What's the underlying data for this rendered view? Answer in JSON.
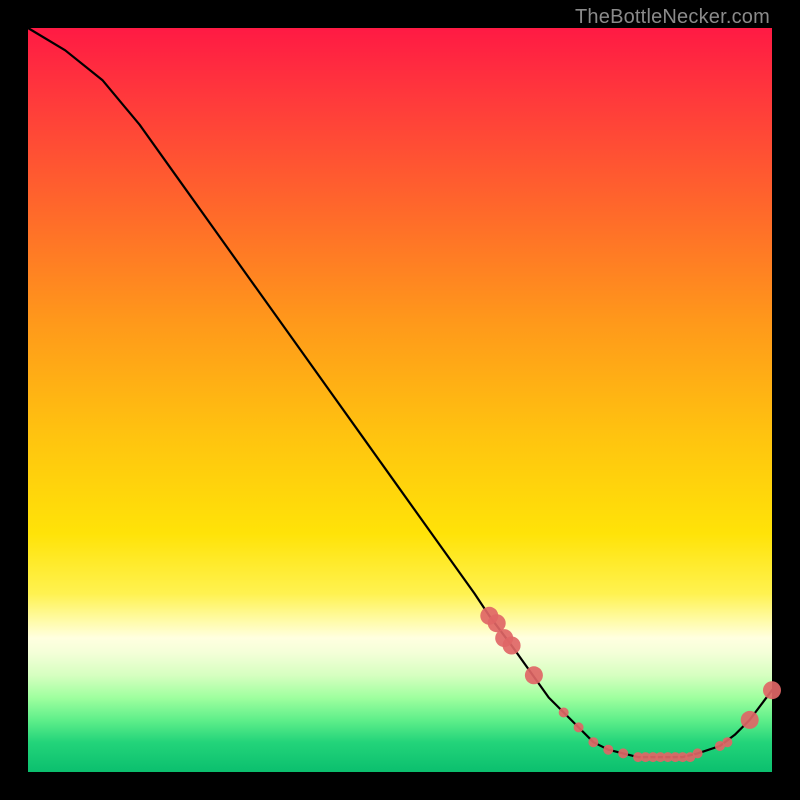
{
  "watermark": {
    "text": "TheBottleNecker.com"
  },
  "chart_data": {
    "type": "line",
    "title": "",
    "xlabel": "",
    "ylabel": "",
    "xlim": [
      0,
      100
    ],
    "ylim": [
      0,
      100
    ],
    "series": [
      {
        "name": "bottleneck-curve",
        "x": [
          0,
          5,
          10,
          15,
          20,
          25,
          30,
          35,
          40,
          45,
          50,
          55,
          60,
          62,
          65,
          70,
          72,
          74,
          76,
          78,
          80,
          82,
          84,
          86,
          88,
          90,
          93,
          95,
          97,
          100
        ],
        "values": [
          100,
          97,
          93,
          87,
          80,
          73,
          66,
          59,
          52,
          45,
          38,
          31,
          24,
          21,
          17,
          10,
          8,
          6,
          4,
          3,
          2.5,
          2,
          2,
          2,
          2,
          2.5,
          3.5,
          5,
          7,
          11
        ]
      }
    ],
    "markers": {
      "name": "highlight-points",
      "x": [
        62,
        63,
        64,
        65,
        68,
        72,
        74,
        76,
        78,
        80,
        82,
        83,
        84,
        85,
        86,
        87,
        88,
        89,
        90,
        93,
        94,
        97,
        100
      ],
      "values": [
        21,
        20,
        18,
        17,
        13,
        8,
        6,
        4,
        3,
        2.5,
        2,
        2,
        2,
        2,
        2,
        2,
        2,
        2,
        2.5,
        3.5,
        4,
        7,
        11
      ],
      "color": "#e06666",
      "radius_small": 5,
      "radius_large": 9
    },
    "gradient_stops": [
      {
        "pos": 0,
        "color": "#ff1a44"
      },
      {
        "pos": 80,
        "color": "#fff250"
      },
      {
        "pos": 100,
        "color": "#0bbf6e"
      }
    ]
  }
}
